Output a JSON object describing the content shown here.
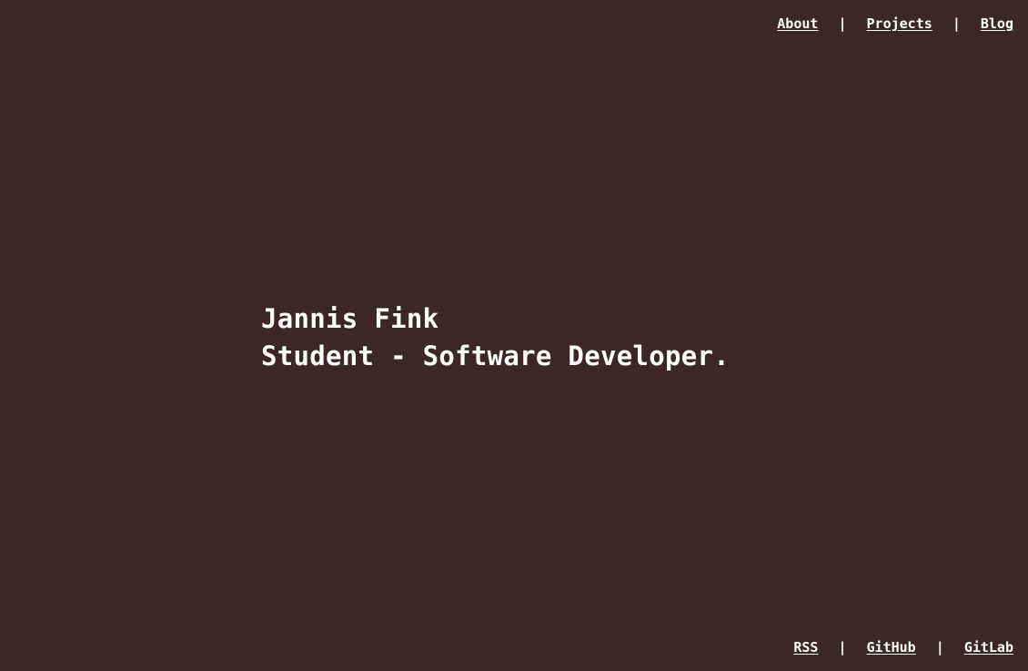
{
  "header_nav": {
    "items": [
      {
        "label": "About"
      },
      {
        "label": "Projects"
      },
      {
        "label": "Blog"
      }
    ],
    "separator": "|"
  },
  "hero": {
    "name": "Jannis Fink",
    "tagline": "Student - Software Developer."
  },
  "footer_nav": {
    "items": [
      {
        "label": "RSS"
      },
      {
        "label": "GitHub"
      },
      {
        "label": "GitLab"
      }
    ],
    "separator": "|"
  },
  "colors": {
    "background": "#3c2627",
    "text": "#ffffff"
  }
}
